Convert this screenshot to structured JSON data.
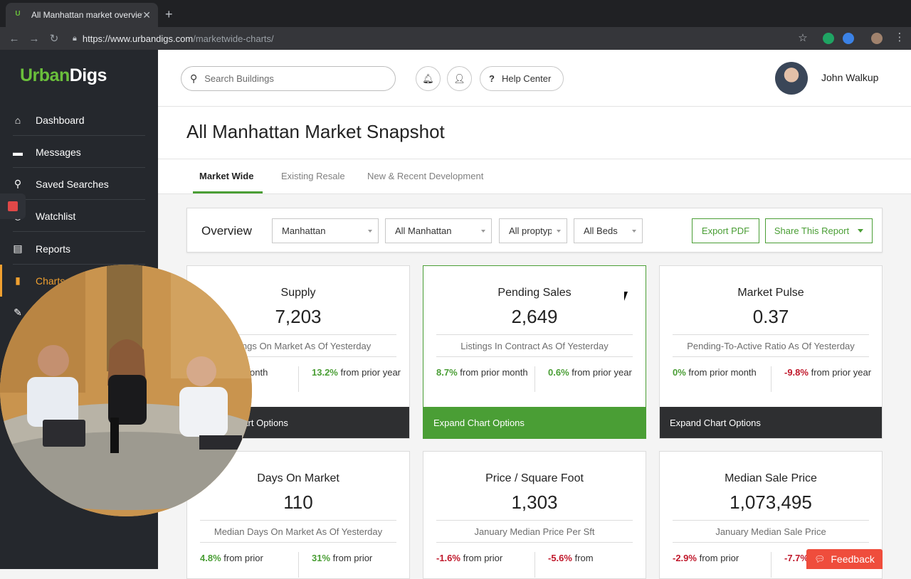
{
  "browser": {
    "tab_title": "All Manhattan market overview",
    "favicon": "U",
    "url_host": "https://www.urbandigs.com",
    "url_path": "/marketwide-charts/"
  },
  "sidebar": {
    "logo_part1": "Urban",
    "logo_part2": "Digs",
    "items": [
      {
        "label": "Dashboard",
        "icon": "home-icon"
      },
      {
        "label": "Messages",
        "icon": "chat-icon"
      },
      {
        "label": "Saved Searches",
        "icon": "search-icon"
      },
      {
        "label": "Watchlist",
        "icon": "eye-icon"
      },
      {
        "label": "Reports",
        "icon": "document-icon"
      },
      {
        "label": "Charts",
        "icon": "bar-chart-icon"
      }
    ]
  },
  "header": {
    "search_placeholder": "Search Buildings",
    "help_label": "Help Center",
    "user_name": "John Walkup"
  },
  "page": {
    "title": "All Manhattan Market Snapshot",
    "tabs": [
      "Market Wide",
      "Existing Resale",
      "New & Recent Development"
    ]
  },
  "overview": {
    "label": "Overview",
    "filters": [
      "Manhattan",
      "All Manhattan",
      "All proptypes",
      "All Beds"
    ],
    "export_label": "Export PDF",
    "share_label": "Share This Report"
  },
  "cards": [
    {
      "title": "Supply",
      "value": "7,203",
      "subtitle": "Listings On Market As Of Yesterday",
      "stat1_n": "",
      "stat1_t": "from prior month",
      "stat2_n": "13.2%",
      "stat2_t": " from prior year",
      "footer": "Expand Chart Options"
    },
    {
      "title": "Pending Sales",
      "value": "2,649",
      "subtitle": "Listings In Contract As Of Yesterday",
      "stat1_n": "8.7%",
      "stat1_t": " from prior month",
      "stat2_n": "0.6%",
      "stat2_t": " from prior year",
      "footer": "Expand Chart Options"
    },
    {
      "title": "Market Pulse",
      "value": "0.37",
      "subtitle": "Pending-To-Active Ratio As Of Yesterday",
      "stat1_n": "0%",
      "stat1_t": " from prior month",
      "stat2_n": "-9.8%",
      "stat2_t": " from prior year",
      "footer": "Expand Chart Options"
    },
    {
      "title": "Days On Market",
      "value": "110",
      "subtitle": "Median Days On Market As Of Yesterday",
      "stat1_n": "4.8%",
      "stat1_t": " from prior",
      "stat2_n": "31%",
      "stat2_t": " from prior"
    },
    {
      "title": "Price / Square Foot",
      "value": "1,303",
      "subtitle": "January Median Price Per Sft",
      "stat1_n": "-1.6%",
      "stat1_t": " from prior",
      "stat2_n": "-5.6%",
      "stat2_t": " from"
    },
    {
      "title": "Median Sale Price",
      "value": "1,073,495",
      "subtitle": "January Median Sale Price",
      "stat1_n": "-2.9%",
      "stat1_t": " from prior",
      "stat2_n": "-7.7%",
      "stat2_t": ""
    }
  ],
  "feedback_label": "Feedback",
  "colors": {
    "accent": "#4a9e35",
    "negative": "#c0182b",
    "sidebar": "#25282d",
    "active_nav": "#f0a030",
    "feedback": "#ef4d3c"
  }
}
